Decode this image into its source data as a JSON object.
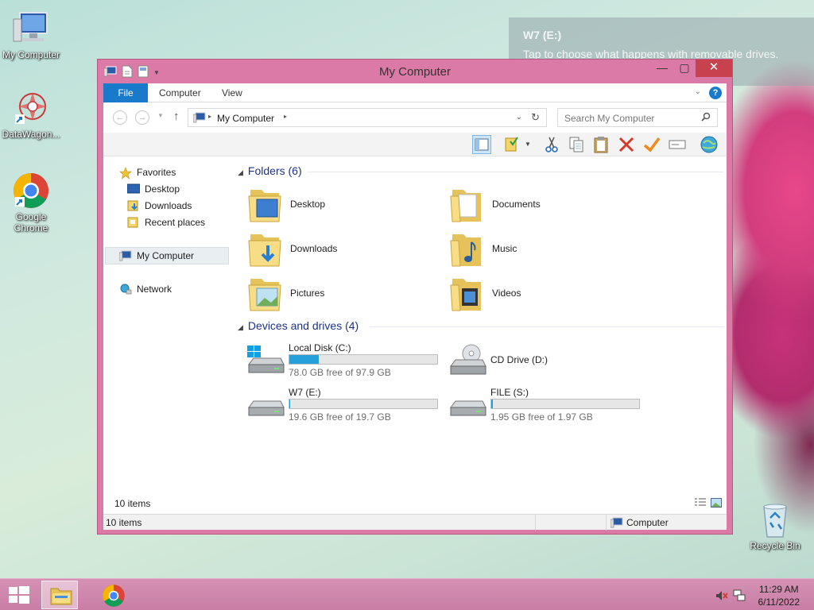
{
  "desktop": {
    "icons": [
      {
        "label": "My Computer"
      },
      {
        "label": "DataWagon..."
      },
      {
        "label": "Google Chrome"
      },
      {
        "label": "Recycle Bin"
      }
    ]
  },
  "toast": {
    "title": "W7 (E:)",
    "message": "Tap to choose what happens with removable drives."
  },
  "window": {
    "title": "My Computer",
    "ribbon_tabs": [
      "File",
      "Computer",
      "View"
    ],
    "address": "My Computer",
    "search_placeholder": "Search My Computer",
    "nav": {
      "favorites": "Favorites",
      "desktop": "Desktop",
      "downloads": "Downloads",
      "recent": "Recent places",
      "computer": "My Computer",
      "network": "Network"
    },
    "folders_header": "Folders (6)",
    "folders": [
      "Desktop",
      "Documents",
      "Downloads",
      "Music",
      "Pictures",
      "Videos"
    ],
    "drives_header": "Devices and drives (4)",
    "drives": [
      {
        "name": "Local Disk (C:)",
        "free": "78.0 GB free of 97.9 GB",
        "used_fraction": 0.2
      },
      {
        "name": "CD Drive (D:)"
      },
      {
        "name": "W7 (E:)",
        "free": "19.6 GB free of 19.7 GB",
        "used_fraction": 0.005
      },
      {
        "name": "FILE (S:)",
        "free": "1.95 GB free of 1.97 GB",
        "used_fraction": 0.01
      }
    ],
    "item_count": "10 items",
    "status_left": "10 items",
    "status_right": "Computer"
  },
  "taskbar": {
    "time": "11:29 AM",
    "date": "6/11/2022"
  },
  "colors": {
    "accent": "#1979ca",
    "drive_bar": "#26a0da",
    "window_frame": "#db7aa6",
    "close_button": "#c7414e"
  }
}
